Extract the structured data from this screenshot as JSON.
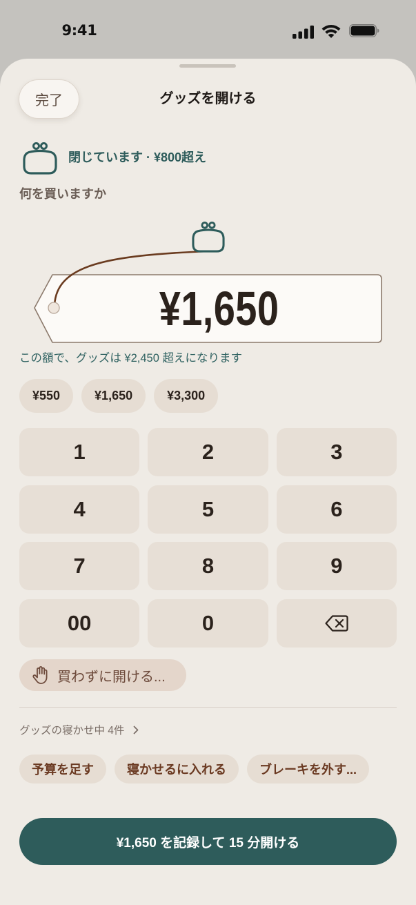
{
  "status_bar": {
    "time": "9:41",
    "signal_bars": 4,
    "battery_level": 1.0,
    "icons": [
      "cellular-signal-icon",
      "wifi-icon",
      "battery-icon"
    ]
  },
  "header": {
    "done_label": "完了",
    "title": "グッズを開ける"
  },
  "status": {
    "icon": "purse-icon",
    "text": "閉じています · ¥800超え"
  },
  "question": "何を買いますか",
  "tag": {
    "icon": "purse-icon",
    "amount": "¥1,650"
  },
  "hint": "この額で、グッズは ¥2,450 超えになります",
  "presets": [
    "¥550",
    "¥1,650",
    "¥3,300"
  ],
  "keypad": {
    "keys": [
      "1",
      "2",
      "3",
      "4",
      "5",
      "6",
      "7",
      "8",
      "9",
      "00",
      "0"
    ],
    "backspace_icon": "backspace-icon"
  },
  "skip_button": {
    "icon": "hand-icon",
    "label": "買わずに開ける..."
  },
  "sleeping": {
    "label": "グッズの寝かせ中 4件",
    "chevron_icon": "chevron-right-icon"
  },
  "actions": [
    "予算を足す",
    "寝かせるに入れる",
    "ブレーキを外す..."
  ],
  "primary_button": {
    "label": "¥1,650 を記録して 15 分開ける"
  },
  "colors": {
    "accent": "#2e5c5b",
    "sheet_background": "#efebe5",
    "status_bar_background": "#c4c2be",
    "key_background": "#e7dfd6",
    "chip_background": "#e6ddd3",
    "chip_text": "#6b3a22",
    "skip_background": "#e4d6cb",
    "tag_string": "#6a3b1f"
  }
}
